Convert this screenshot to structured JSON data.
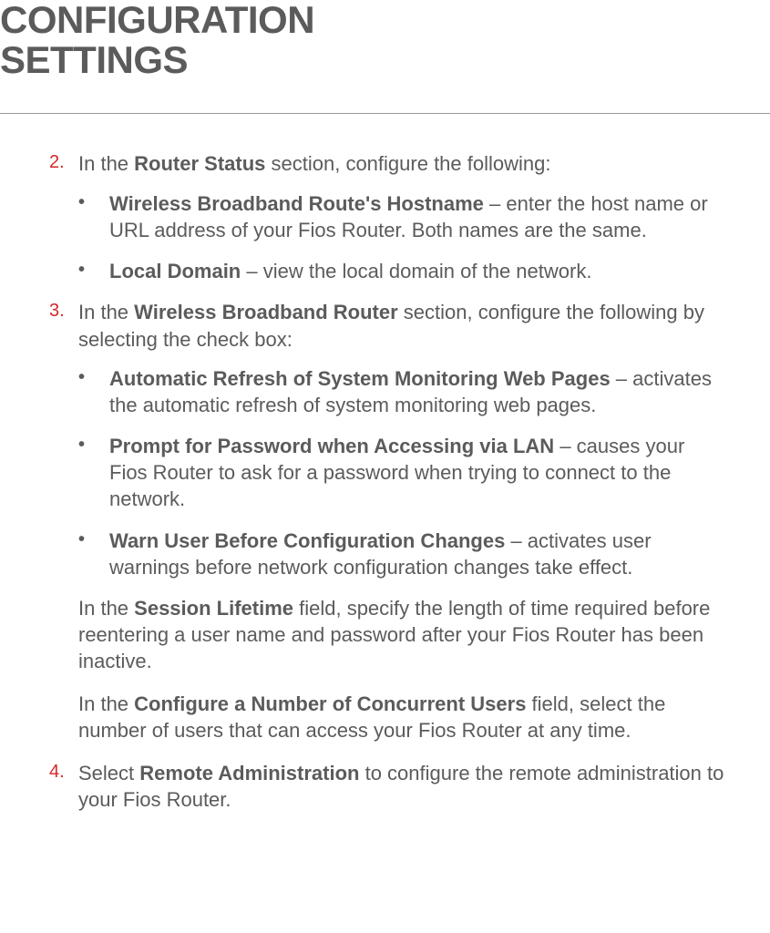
{
  "header": {
    "title_line1": "CONFIGURATION",
    "title_line2": "SETTINGS"
  },
  "steps": {
    "step2": {
      "num": "2.",
      "lead": "In the ",
      "bold1": "Router Status",
      "rest": " section, configure the following:",
      "bullets": [
        {
          "bold": "Wireless Broadband Route's Hostname",
          "rest": " – enter the host name or URL address of your Fios Router. Both names are the same."
        },
        {
          "bold": "Local Domain",
          "rest": " – view the local domain of the network."
        }
      ]
    },
    "step3": {
      "num": "3.",
      "lead": "In the ",
      "bold1": "Wireless Broadband Router",
      "rest": " section, configure the following by selecting the check box:",
      "bullets": [
        {
          "bold": "Automatic Refresh of System Monitoring Web Pages",
          "rest": " – activates the automatic refresh of system monitoring web pages."
        },
        {
          "bold": "Prompt for Password when Accessing via LAN",
          "rest": " – causes your Fios Router to ask for a password when trying to connect to the network."
        },
        {
          "bold": "Warn User Before Configuration Changes",
          "rest": " – activates user warnings before network configuration changes take effect."
        }
      ],
      "para1": {
        "lead": "In the ",
        "bold": "Session Lifetime",
        "rest": " field, specify the length of time required before reentering a user name and password after your Fios Router has been inactive."
      },
      "para2": {
        "lead": "In the ",
        "bold": "Configure a Number of Concurrent Users",
        "rest": " field, select the number of users that can access your Fios Router at any time."
      }
    },
    "step4": {
      "num": "4.",
      "lead": "Select ",
      "bold1": "Remote Administration",
      "rest": " to configure the remote administration to your Fios Router."
    }
  }
}
